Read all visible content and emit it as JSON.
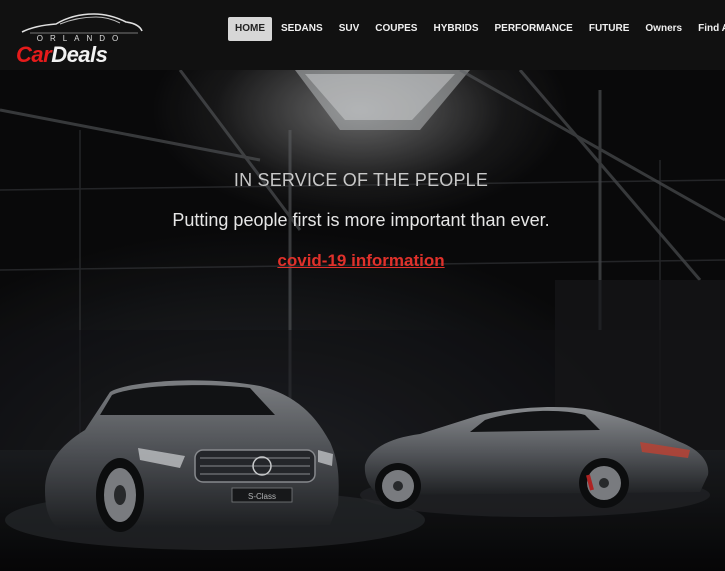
{
  "brand": {
    "sub": "ORLANDO",
    "main_1": "Car",
    "main_2": "Deals",
    "accent": "#e51b1b"
  },
  "nav": {
    "items": [
      {
        "label": "HOME",
        "active": true
      },
      {
        "label": "SEDANS"
      },
      {
        "label": "SUV"
      },
      {
        "label": "COUPES"
      },
      {
        "label": "HYBRIDS"
      },
      {
        "label": "PERFORMANCE"
      },
      {
        "label": "FUTURE"
      },
      {
        "label": "Owners"
      },
      {
        "label": "Find A Deal"
      }
    ]
  },
  "hero": {
    "eyebrow": "IN SERVICE OF THE PEOPLE",
    "subline": "Putting people first is more important than ever.",
    "link": "covid-19 information",
    "link_color": "#e0312b",
    "plate": "S-Class"
  }
}
